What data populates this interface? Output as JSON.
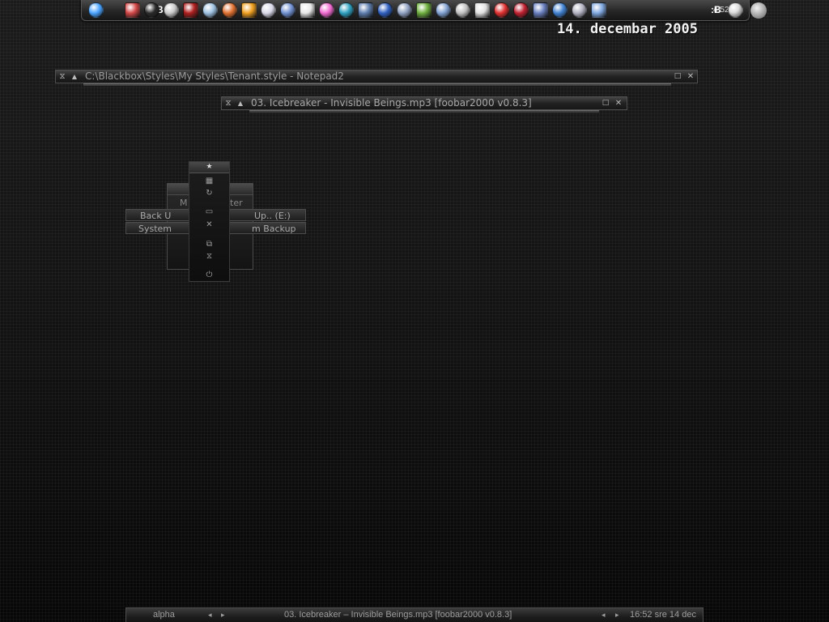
{
  "dock": {
    "clock": "4:52",
    "blackbox_label": ":B",
    "icons": [
      {
        "name": "qt-app-icon",
        "color": "#4aa3ff"
      },
      {
        "name": "calendar-icon",
        "color": "#d44848"
      },
      {
        "name": "blackbox-icon",
        "color": "#2a2a2a"
      },
      {
        "name": "lifebuoy-icon",
        "color": "#c8c8c8"
      },
      {
        "name": "red-disc-icon",
        "color": "#b02020"
      },
      {
        "name": "network-icon",
        "color": "#9cc0e0"
      },
      {
        "name": "paint-icon",
        "color": "#e07030"
      },
      {
        "name": "fruity-loops-icon",
        "color": "#f0a020"
      },
      {
        "name": "cd-burn-icon",
        "color": "#d8d8e8"
      },
      {
        "name": "notepad-icon",
        "color": "#7090d0"
      },
      {
        "name": "flower-icon",
        "color": "#e8e8e8"
      },
      {
        "name": "colors-icon",
        "color": "#f06ad0"
      },
      {
        "name": "media-player-icon",
        "color": "#2fa0c0"
      },
      {
        "name": "monitor-icon",
        "color": "#6080b0"
      },
      {
        "name": "picture-icon",
        "color": "#3060c0"
      },
      {
        "name": "tools-icon",
        "color": "#90a0c0"
      },
      {
        "name": "gear-green-icon",
        "color": "#70b040"
      },
      {
        "name": "settings-icon",
        "color": "#80a0d0"
      },
      {
        "name": "cog-icon",
        "color": "#c0c0c0"
      },
      {
        "name": "optical-drive-icon",
        "color": "#e0e0e0"
      },
      {
        "name": "shield-red-icon",
        "color": "#e03030"
      },
      {
        "name": "antivirus-icon",
        "color": "#c02030"
      },
      {
        "name": "firefox-icon",
        "color": "#6a80c0"
      },
      {
        "name": "globe-icon",
        "color": "#4080d0"
      },
      {
        "name": "windows-icon",
        "color": "#b0b0c0"
      },
      {
        "name": "wrench-icon",
        "color": "#80a8e0"
      }
    ]
  },
  "date_overlay": "14. decembar 2005",
  "windows": {
    "notepad": {
      "title": "C:\\Blackbox\\Styles\\My Styles\\Tenant.style - Notepad2"
    },
    "foobar": {
      "title": "03. Icebreaker - Invisible Beings.mp3     [foobar2000 v0.8.3]"
    }
  },
  "menus": {
    "backup": {
      "row1_left": "Back U",
      "row1_right": "Up.. (E:)",
      "row2_left": "System",
      "row2_right": "m Backup"
    },
    "middle": {
      "partial": "M",
      "partial_right": "ter"
    },
    "icon_menu": {
      "items": [
        {
          "name": "favorites-icon",
          "glyph": "★"
        },
        {
          "name": "workspaces-icon",
          "glyph": "▦"
        },
        {
          "name": "refresh-icon",
          "glyph": "↻"
        },
        {
          "name": "folder-icon",
          "glyph": "▭"
        },
        {
          "name": "tools-menu-icon",
          "glyph": "✕"
        },
        {
          "name": "windows-menu-icon",
          "glyph": "⧉"
        },
        {
          "name": "blackbox-menu-icon",
          "glyph": "⧖"
        },
        {
          "name": "shutdown-icon",
          "glyph": "⏻"
        }
      ]
    }
  },
  "taskbar": {
    "workspace": "alpha",
    "task": "03. Icebreaker – Invisible Beings.mp3     [foobar2000 v0.8.3]",
    "clock": "16:52 sre 14 dec",
    "prev": "◂",
    "next": "▸"
  }
}
